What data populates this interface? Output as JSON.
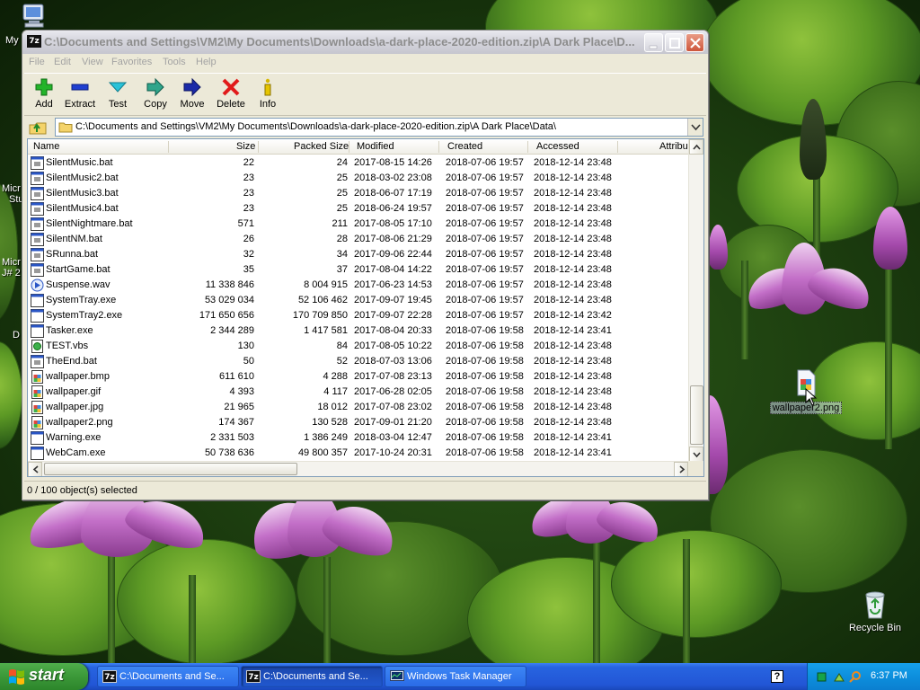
{
  "window": {
    "title": "C:\\Documents and Settings\\VM2\\My Documents\\Downloads\\a-dark-place-2020-edition.zip\\A Dark Place\\D...",
    "app_icon": "7z"
  },
  "menu": [
    "File",
    "Edit",
    "View",
    "Favorites",
    "Tools",
    "Help"
  ],
  "toolbar": [
    {
      "label": "Add",
      "icon": "add-icon"
    },
    {
      "label": "Extract",
      "icon": "extract-icon"
    },
    {
      "label": "Test",
      "icon": "test-icon"
    },
    {
      "label": "Copy",
      "icon": "copy-icon"
    },
    {
      "label": "Move",
      "icon": "move-icon"
    },
    {
      "label": "Delete",
      "icon": "delete-icon"
    },
    {
      "label": "Info",
      "icon": "info-icon"
    }
  ],
  "address": "C:\\Documents and Settings\\VM2\\My Documents\\Downloads\\a-dark-place-2020-edition.zip\\A Dark Place\\Data\\",
  "columns": [
    "Name",
    "Size",
    "Packed Size",
    "Modified",
    "Created",
    "Accessed",
    "Attribu"
  ],
  "files": [
    {
      "icon": "bat",
      "name": "SilentMusic.bat",
      "size": "22",
      "packed": "24",
      "modified": "2017-08-15 14:26",
      "created": "2018-07-06 19:57",
      "accessed": "2018-12-14 23:48"
    },
    {
      "icon": "bat",
      "name": "SilentMusic2.bat",
      "size": "23",
      "packed": "25",
      "modified": "2018-03-02 23:08",
      "created": "2018-07-06 19:57",
      "accessed": "2018-12-14 23:48"
    },
    {
      "icon": "bat",
      "name": "SilentMusic3.bat",
      "size": "23",
      "packed": "25",
      "modified": "2018-06-07 17:19",
      "created": "2018-07-06 19:57",
      "accessed": "2018-12-14 23:48"
    },
    {
      "icon": "bat",
      "name": "SilentMusic4.bat",
      "size": "23",
      "packed": "25",
      "modified": "2018-06-24 19:57",
      "created": "2018-07-06 19:57",
      "accessed": "2018-12-14 23:48"
    },
    {
      "icon": "bat",
      "name": "SilentNightmare.bat",
      "size": "571",
      "packed": "211",
      "modified": "2017-08-05 17:10",
      "created": "2018-07-06 19:57",
      "accessed": "2018-12-14 23:48"
    },
    {
      "icon": "bat",
      "name": "SilentNM.bat",
      "size": "26",
      "packed": "28",
      "modified": "2017-08-06 21:29",
      "created": "2018-07-06 19:57",
      "accessed": "2018-12-14 23:48"
    },
    {
      "icon": "bat",
      "name": "SRunna.bat",
      "size": "32",
      "packed": "34",
      "modified": "2017-09-06 22:44",
      "created": "2018-07-06 19:57",
      "accessed": "2018-12-14 23:48"
    },
    {
      "icon": "bat",
      "name": "StartGame.bat",
      "size": "35",
      "packed": "37",
      "modified": "2017-08-04 14:22",
      "created": "2018-07-06 19:57",
      "accessed": "2018-12-14 23:48"
    },
    {
      "icon": "wav",
      "name": "Suspense.wav",
      "size": "11 338 846",
      "packed": "8 004 915",
      "modified": "2017-06-23 14:53",
      "created": "2018-07-06 19:57",
      "accessed": "2018-12-14 23:48"
    },
    {
      "icon": "exe",
      "name": "SystemTray.exe",
      "size": "53 029 034",
      "packed": "52 106 462",
      "modified": "2017-09-07 19:45",
      "created": "2018-07-06 19:57",
      "accessed": "2018-12-14 23:48"
    },
    {
      "icon": "exe",
      "name": "SystemTray2.exe",
      "size": "171 650 656",
      "packed": "170 709 850",
      "modified": "2017-09-07 22:28",
      "created": "2018-07-06 19:57",
      "accessed": "2018-12-14 23:42"
    },
    {
      "icon": "exe",
      "name": "Tasker.exe",
      "size": "2 344 289",
      "packed": "1 417 581",
      "modified": "2017-08-04 20:33",
      "created": "2018-07-06 19:58",
      "accessed": "2018-12-14 23:41"
    },
    {
      "icon": "vbs",
      "name": "TEST.vbs",
      "size": "130",
      "packed": "84",
      "modified": "2017-08-05 10:22",
      "created": "2018-07-06 19:58",
      "accessed": "2018-12-14 23:48"
    },
    {
      "icon": "bat",
      "name": "TheEnd.bat",
      "size": "50",
      "packed": "52",
      "modified": "2018-07-03 13:06",
      "created": "2018-07-06 19:58",
      "accessed": "2018-12-14 23:48"
    },
    {
      "icon": "img",
      "name": "wallpaper.bmp",
      "size": "611 610",
      "packed": "4 288",
      "modified": "2017-07-08 23:13",
      "created": "2018-07-06 19:58",
      "accessed": "2018-12-14 23:48"
    },
    {
      "icon": "img",
      "name": "wallpaper.gif",
      "size": "4 393",
      "packed": "4 117",
      "modified": "2017-06-28 02:05",
      "created": "2018-07-06 19:58",
      "accessed": "2018-12-14 23:48"
    },
    {
      "icon": "img",
      "name": "wallpaper.jpg",
      "size": "21 965",
      "packed": "18 012",
      "modified": "2017-07-08 23:02",
      "created": "2018-07-06 19:58",
      "accessed": "2018-12-14 23:48"
    },
    {
      "icon": "img",
      "name": "wallpaper2.png",
      "size": "174 367",
      "packed": "130 528",
      "modified": "2017-09-01 21:20",
      "created": "2018-07-06 19:58",
      "accessed": "2018-12-14 23:48"
    },
    {
      "icon": "exe",
      "name": "Warning.exe",
      "size": "2 331 503",
      "packed": "1 386 249",
      "modified": "2018-03-04 12:47",
      "created": "2018-07-06 19:58",
      "accessed": "2018-12-14 23:41"
    },
    {
      "icon": "exe",
      "name": "WebCam.exe",
      "size": "50 738 636",
      "packed": "49 800 357",
      "modified": "2017-10-24 20:31",
      "created": "2018-07-06 19:58",
      "accessed": "2018-12-14 23:41"
    }
  ],
  "status": "0 / 100 object(s) selected",
  "drag_label": "wallpaper2.png",
  "desktop": {
    "recycle_bin": "Recycle Bin",
    "partial_labels": [
      "My",
      "Micr",
      "Stu",
      "Micr",
      "J# 2",
      "D"
    ]
  },
  "taskbar": {
    "start": "start",
    "tasks": [
      {
        "label": "C:\\Documents and Se...",
        "icon": "7z"
      },
      {
        "label": "C:\\Documents and Se...",
        "icon": "7z"
      },
      {
        "label": "Windows Task Manager",
        "icon": "taskmgr"
      }
    ],
    "clock": "6:37 PM",
    "help": "?"
  }
}
